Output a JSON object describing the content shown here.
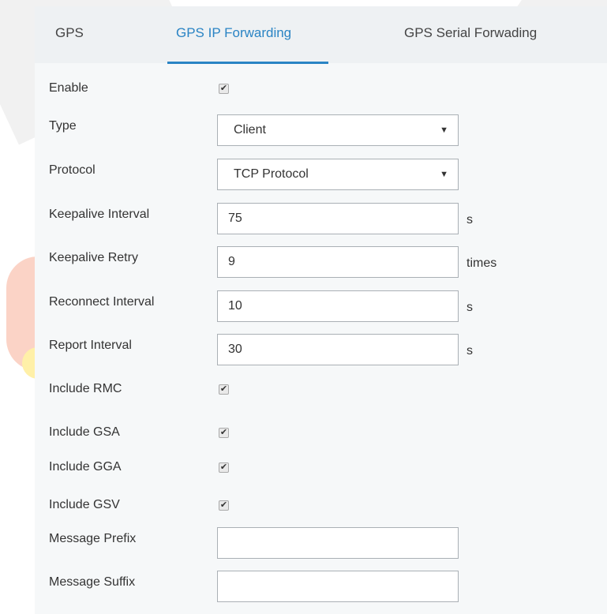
{
  "tabs": [
    {
      "label": "GPS"
    },
    {
      "label": "GPS IP Forwarding"
    },
    {
      "label": "GPS Serial Forwading"
    }
  ],
  "form": {
    "enable": {
      "label": "Enable",
      "checked": true
    },
    "type": {
      "label": "Type",
      "value": "Client"
    },
    "protocol": {
      "label": "Protocol",
      "value": "TCP Protocol"
    },
    "keepalive_interval": {
      "label": "Keepalive Interval",
      "value": "75",
      "unit": "s"
    },
    "keepalive_retry": {
      "label": "Keepalive Retry",
      "value": "9",
      "unit": "times"
    },
    "reconnect_interval": {
      "label": "Reconnect Interval",
      "value": "10",
      "unit": "s"
    },
    "report_interval": {
      "label": "Report Interval",
      "value": "30",
      "unit": "s"
    },
    "include_rmc": {
      "label": "Include RMC",
      "checked": true
    },
    "include_gsa": {
      "label": "Include GSA",
      "checked": true
    },
    "include_gga": {
      "label": "Include GGA",
      "checked": true
    },
    "include_gsv": {
      "label": "Include GSV",
      "checked": true
    },
    "message_prefix": {
      "label": "Message Prefix",
      "value": ""
    },
    "message_suffix": {
      "label": "Message Suffix",
      "value": ""
    }
  },
  "glyphs": {
    "check": "✔",
    "dropdown_arrow": "▼"
  },
  "colors": {
    "accent": "#2a84c4"
  }
}
